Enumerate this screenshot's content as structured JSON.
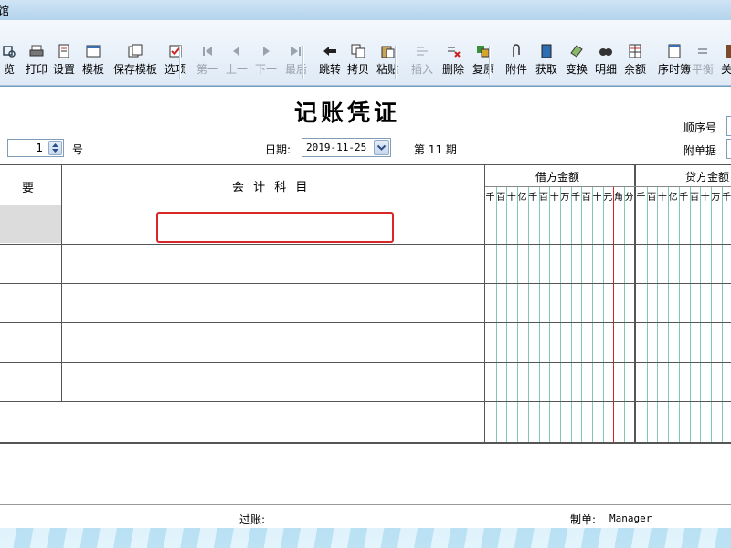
{
  "window": {
    "title_fragment": "馆"
  },
  "toolbar": {
    "items": [
      {
        "label": "览",
        "icon": "preview-icon",
        "enabled": true
      },
      {
        "label": "打印",
        "icon": "print-icon",
        "enabled": true
      },
      {
        "label": "设置",
        "icon": "settings-icon",
        "enabled": true
      },
      {
        "label": "模板",
        "icon": "template-icon",
        "enabled": true
      },
      {
        "label": "保存模板",
        "icon": "save-template-icon",
        "enabled": true
      },
      {
        "label": "选项",
        "icon": "options-icon",
        "enabled": true
      },
      {
        "label": "第一",
        "icon": "first-icon",
        "enabled": false
      },
      {
        "label": "上一",
        "icon": "prev-icon",
        "enabled": false
      },
      {
        "label": "下一",
        "icon": "next-icon",
        "enabled": false
      },
      {
        "label": "最后",
        "icon": "last-icon",
        "enabled": false
      },
      {
        "label": "跳转",
        "icon": "jump-icon",
        "enabled": true
      },
      {
        "label": "拷贝",
        "icon": "copy-icon",
        "enabled": true
      },
      {
        "label": "粘贴",
        "icon": "paste-icon",
        "enabled": true
      },
      {
        "label": "插入",
        "icon": "insert-icon",
        "enabled": false
      },
      {
        "label": "删除",
        "icon": "delete-icon",
        "enabled": true
      },
      {
        "label": "复原",
        "icon": "restore-icon",
        "enabled": true
      },
      {
        "label": "附件",
        "icon": "attachment-icon",
        "enabled": true
      },
      {
        "label": "获取",
        "icon": "fetch-icon",
        "enabled": true
      },
      {
        "label": "变换",
        "icon": "transform-icon",
        "enabled": true
      },
      {
        "label": "明细",
        "icon": "detail-icon",
        "enabled": true
      },
      {
        "label": "余额",
        "icon": "balance-icon",
        "enabled": true
      },
      {
        "label": "序时簿",
        "icon": "journal-icon",
        "enabled": true
      },
      {
        "label": "平衡",
        "icon": "balance-check-icon",
        "enabled": false
      },
      {
        "label": "关讠",
        "icon": "close-icon",
        "enabled": true
      }
    ]
  },
  "voucher": {
    "title": "记账凭证",
    "number_value": "1",
    "number_suffix": "号",
    "date_label": "日期:",
    "date_value": "2019-11-25",
    "period_text": "第 11 期",
    "seq_label": "顺序号",
    "attach_label": "附单据"
  },
  "grid": {
    "col_summary": "要",
    "col_account": "会 计 科 目",
    "col_debit": "借方金额",
    "col_credit": "贷方金额",
    "debit_digits": [
      "千",
      "百",
      "十",
      "亿",
      "千",
      "百",
      "十",
      "万",
      "千",
      "百",
      "十",
      "元",
      "角",
      "分"
    ],
    "credit_digits": [
      "千",
      "百",
      "十",
      "亿",
      "千",
      "百",
      "十",
      "万",
      "千"
    ]
  },
  "footer": {
    "posting_label": "过账:",
    "maker_label": "制单:",
    "maker_value": "Manager"
  },
  "colors": {
    "accent_red": "#d92626",
    "amount_line": "#7fc9b9"
  }
}
